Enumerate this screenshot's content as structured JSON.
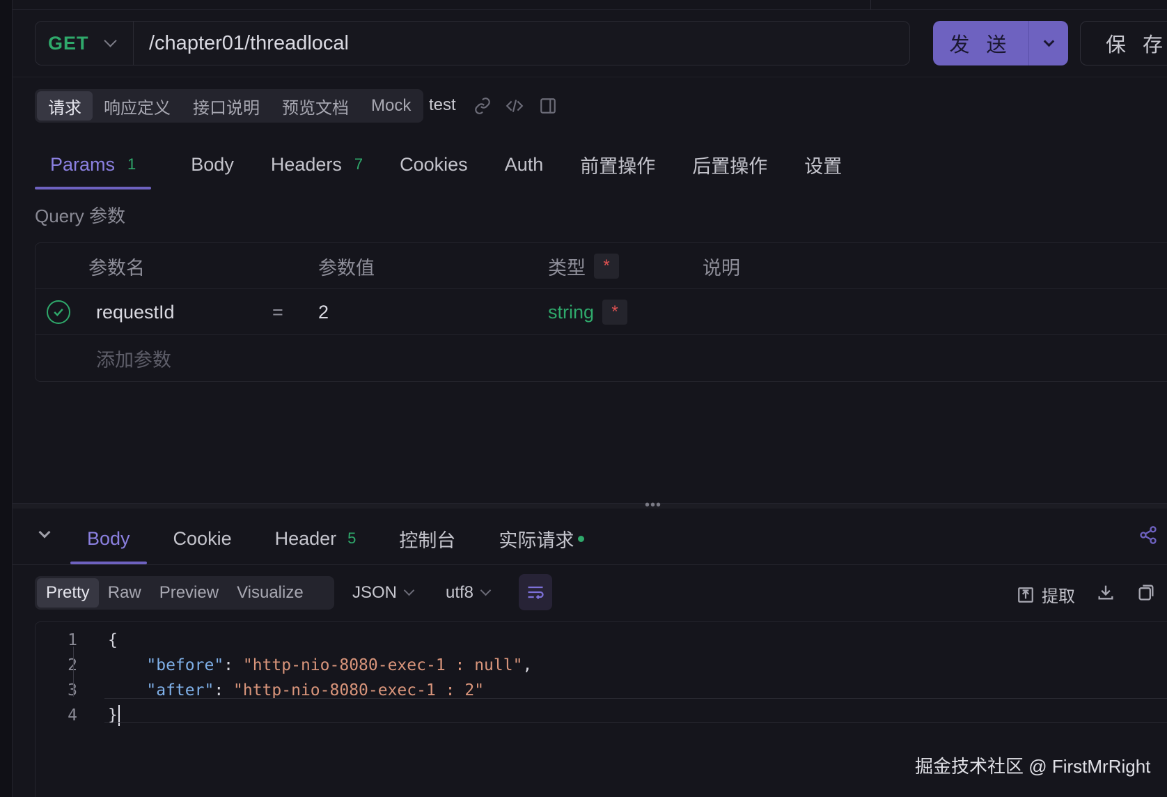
{
  "request": {
    "method": "GET",
    "url": "/chapter01/threadlocal",
    "send_label": "发 送",
    "save_label": "保 存"
  },
  "subtabs": [
    {
      "label": "请求",
      "active": true
    },
    {
      "label": "响应定义",
      "active": false
    },
    {
      "label": "接口说明",
      "active": false
    },
    {
      "label": "预览文档",
      "active": false
    },
    {
      "label": "Mock",
      "active": false
    }
  ],
  "environment": "test",
  "param_tabs": [
    {
      "label": "Params",
      "badge": "1",
      "active": true
    },
    {
      "label": "Body",
      "badge": "",
      "active": false
    },
    {
      "label": "Headers",
      "badge": "7",
      "active": false
    },
    {
      "label": "Cookies",
      "badge": "",
      "active": false
    },
    {
      "label": "Auth",
      "badge": "",
      "active": false
    },
    {
      "label": "前置操作",
      "badge": "",
      "active": false
    },
    {
      "label": "后置操作",
      "badge": "",
      "active": false
    },
    {
      "label": "设置",
      "badge": "",
      "active": false
    }
  ],
  "query": {
    "title": "Query 参数",
    "headers": {
      "name": "参数名",
      "value": "参数值",
      "type": "类型",
      "required_mark": "*",
      "desc": "说明"
    },
    "rows": [
      {
        "enabled": true,
        "name": "requestId",
        "eq": "=",
        "value": "2",
        "type": "string",
        "required_mark": "*"
      }
    ],
    "add_placeholder": "添加参数"
  },
  "splitter_dots": "•••",
  "response_tabs": [
    {
      "label": "Body",
      "badge": "",
      "active": true
    },
    {
      "label": "Cookie",
      "badge": "",
      "active": false
    },
    {
      "label": "Header",
      "badge": "5",
      "active": false
    },
    {
      "label": "控制台",
      "badge": "",
      "active": false
    },
    {
      "label": "实际请求",
      "badge": "",
      "active": false,
      "dot": true
    }
  ],
  "format_tabs": [
    {
      "label": "Pretty",
      "active": true
    },
    {
      "label": "Raw",
      "active": false
    },
    {
      "label": "Preview",
      "active": false
    },
    {
      "label": "Visualize",
      "active": false
    }
  ],
  "format_type": "JSON",
  "encoding": "utf8",
  "extract_label": "提取",
  "code_lines": [
    {
      "num": "1",
      "tokens": [
        {
          "t": "{",
          "c": "punc"
        }
      ]
    },
    {
      "num": "2",
      "tokens": [
        {
          "t": "    \"before\"",
          "c": "key"
        },
        {
          "t": ": ",
          "c": "punc"
        },
        {
          "t": "\"http-nio-8080-exec-1 : null\"",
          "c": "str"
        },
        {
          "t": ",",
          "c": "punc"
        }
      ]
    },
    {
      "num": "3",
      "tokens": [
        {
          "t": "    \"after\"",
          "c": "key"
        },
        {
          "t": ": ",
          "c": "punc"
        },
        {
          "t": "\"http-nio-8080-exec-1 : 2\"",
          "c": "str"
        }
      ]
    },
    {
      "num": "4",
      "tokens": [
        {
          "t": "}",
          "c": "punc"
        }
      ]
    }
  ],
  "watermark": "掘金技术社区 @ FirstMrRight",
  "colors": {
    "accent": "#6e62c0",
    "accent_text": "#8b80e0",
    "green": "#2fa96b",
    "required": "#e05252"
  }
}
